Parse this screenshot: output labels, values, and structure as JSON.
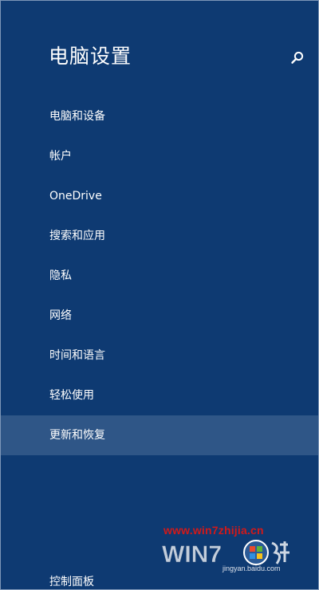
{
  "header": {
    "title": "电脑设置",
    "search_icon": "search-icon"
  },
  "nav": {
    "items": [
      {
        "label": "电脑和设备"
      },
      {
        "label": "帐户"
      },
      {
        "label": "OneDrive"
      },
      {
        "label": "搜索和应用"
      },
      {
        "label": "隐私"
      },
      {
        "label": "网络"
      },
      {
        "label": "时间和语言"
      },
      {
        "label": "轻松使用"
      },
      {
        "label": "更新和恢复",
        "selected": true
      }
    ]
  },
  "footer": {
    "control_panel": "控制面板"
  },
  "watermark": {
    "url": "www.win7zhijia.cn",
    "sub": "jingyan.baidu.com"
  },
  "colors": {
    "background": "#0e3a72",
    "selected": "#2f5687",
    "text": "#ffffff",
    "watermark_red": "#d21919"
  }
}
